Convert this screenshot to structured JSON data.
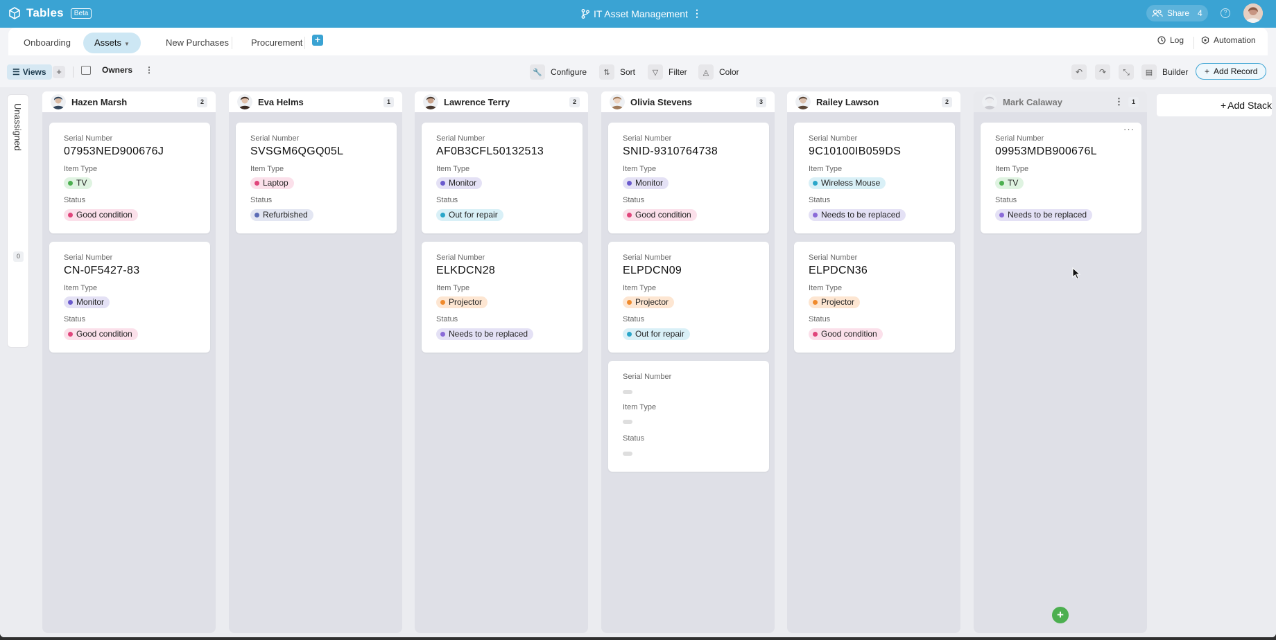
{
  "header": {
    "app_name": "Tables",
    "beta_badge": "Beta",
    "doc_title": "IT Asset Management",
    "share_label": "Share",
    "share_count": "4",
    "accent_color": "#3aa3d3"
  },
  "tabs": [
    {
      "label": "Onboarding",
      "active": false
    },
    {
      "label": "Assets",
      "active": true
    },
    {
      "label": "New Purchases",
      "active": false
    },
    {
      "label": "Procurement",
      "active": false
    }
  ],
  "tab_actions": {
    "log": "Log",
    "automation": "Automation"
  },
  "toolbar": {
    "views": "Views",
    "group_by": "Owners",
    "configure": "Configure",
    "sort": "Sort",
    "filter": "Filter",
    "color": "Color",
    "builder": "Builder",
    "add_record": "Add Record"
  },
  "unassigned": {
    "label": "Unassigned",
    "count": "0"
  },
  "field_labels": {
    "serial": "Serial Number",
    "item_type": "Item Type",
    "status": "Status"
  },
  "stacks": [
    {
      "name": "Hazen Marsh",
      "count": "2",
      "cards": [
        {
          "serial": "07953NED900676J",
          "item_type": "TV",
          "status": "Good condition"
        },
        {
          "serial": "CN-0F5427-83",
          "item_type": "Monitor",
          "status": "Good condition"
        }
      ]
    },
    {
      "name": "Eva Helms",
      "count": "1",
      "cards": [
        {
          "serial": "SVSGM6QGQ05L",
          "item_type": "Laptop",
          "status": "Refurbished"
        }
      ]
    },
    {
      "name": "Lawrence Terry",
      "count": "2",
      "cards": [
        {
          "serial": "AF0B3CFL50132513",
          "item_type": "Monitor",
          "status": "Out for repair"
        },
        {
          "serial": "ELKDCN28",
          "item_type": "Projector",
          "status": "Needs to be replaced"
        }
      ]
    },
    {
      "name": "Olivia Stevens",
      "count": "3",
      "cards": [
        {
          "serial": "SNID-9310764738",
          "item_type": "Monitor",
          "status": "Good condition"
        },
        {
          "serial": "ELPDCN09",
          "item_type": "Projector",
          "status": "Out for repair"
        },
        {
          "serial": "",
          "item_type": "",
          "status": ""
        }
      ]
    },
    {
      "name": "Railey Lawson",
      "count": "2",
      "cards": [
        {
          "serial": "9C10100IB059DS",
          "item_type": "Wireless Mouse",
          "status": "Needs to be replaced"
        },
        {
          "serial": "ELPDCN36",
          "item_type": "Projector",
          "status": "Good condition"
        }
      ]
    },
    {
      "name": "Mark Calaway",
      "count": "1",
      "cards": [
        {
          "serial": "09953MDB900676L",
          "item_type": "TV",
          "status": "Needs to be replaced"
        }
      ]
    }
  ],
  "add_stack": "Add Stack",
  "pill_colors": {
    "TV": {
      "bg": "#dff3e1",
      "dot": "#4caf50"
    },
    "Monitor": {
      "bg": "#e4e1f5",
      "dot": "#6a5acd"
    },
    "Laptop": {
      "bg": "#fbe0ea",
      "dot": "#e0457b"
    },
    "Projector": {
      "bg": "#fde6d2",
      "dot": "#f08a2c"
    },
    "Wireless Mouse": {
      "bg": "#d9f0f7",
      "dot": "#2aa6c9"
    },
    "Good condition": {
      "bg": "#fbe0ea",
      "dot": "#e0457b"
    },
    "Refurbished": {
      "bg": "#e3e6f2",
      "dot": "#5b6bb5"
    },
    "Out for repair": {
      "bg": "#d9f0f7",
      "dot": "#2aa6c9"
    },
    "Needs to be replaced": {
      "bg": "#e4e1f5",
      "dot": "#8a6ad8"
    }
  }
}
